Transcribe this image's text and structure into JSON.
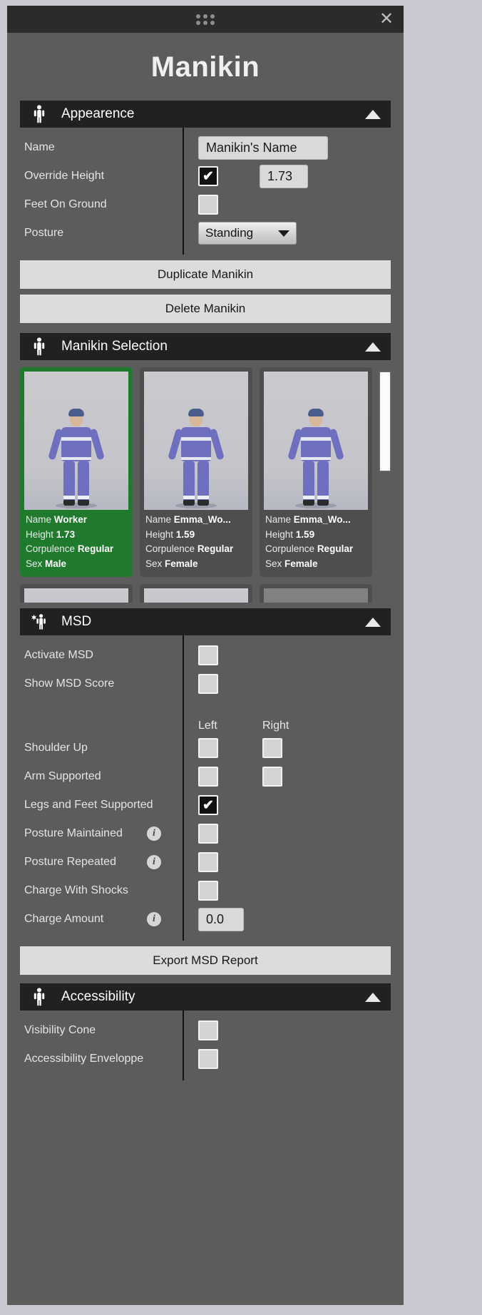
{
  "window": {
    "title": "Manikin",
    "close_label": "✕",
    "drag_handle": "drag-dots"
  },
  "appearance": {
    "header": "Appearence",
    "icon": "person-icon",
    "collapse_icon": "caret-up-icon",
    "rows": {
      "name_label": "Name",
      "name_value": "Manikin's Name",
      "override_height_label": "Override Height",
      "override_height_checked": true,
      "height_value": "1.73",
      "feet_on_ground_label": "Feet On Ground",
      "feet_on_ground_checked": false,
      "posture_label": "Posture",
      "posture_value": "Standing"
    },
    "duplicate_button": "Duplicate Manikin",
    "delete_button": "Delete Manikin"
  },
  "manikin_selection": {
    "header": "Manikin Selection",
    "icon": "person-icon",
    "collapse_icon": "caret-up-icon",
    "field_labels": {
      "name": "Name",
      "height": "Height",
      "corpulence": "Corpulence",
      "sex": "Sex"
    },
    "cards": [
      {
        "name": "Worker",
        "height": "1.73",
        "corpulence": "Regular",
        "sex": "Male",
        "selected": true,
        "cap_color": "#4a5c8c"
      },
      {
        "name": "Emma_Wo...",
        "height": "1.59",
        "corpulence": "Regular",
        "sex": "Female",
        "selected": false,
        "cap_color": "#4a5c8c"
      },
      {
        "name": "Emma_Wo...",
        "height": "1.59",
        "corpulence": "Regular",
        "sex": "Female",
        "selected": false,
        "cap_color": "#4a5c8c"
      }
    ],
    "partial_cards": [
      {
        "head_color": "#3b4f86",
        "dimmed": false
      },
      {
        "head_color": "#3fa05a",
        "dimmed": false
      },
      {
        "head_color": "#2b2018",
        "dimmed": true
      }
    ]
  },
  "msd": {
    "header": "MSD",
    "icon": "star-person-icon",
    "collapse_icon": "caret-up-icon",
    "activate_label": "Activate MSD",
    "activate_checked": false,
    "show_score_label": "Show MSD Score",
    "show_score_checked": false,
    "col_left": "Left",
    "col_right": "Right",
    "rows": [
      {
        "label": "Shoulder Up",
        "left": false,
        "right": false,
        "has_info": false,
        "two_sided": true
      },
      {
        "label": "Arm Supported",
        "left": false,
        "right": false,
        "has_info": false,
        "two_sided": true
      },
      {
        "label": "Legs and Feet Supported",
        "left": true,
        "right": null,
        "has_info": false,
        "two_sided": false
      },
      {
        "label": "Posture Maintained",
        "left": false,
        "right": null,
        "has_info": true,
        "two_sided": false
      },
      {
        "label": "Posture Repeated",
        "left": false,
        "right": null,
        "has_info": true,
        "two_sided": false
      },
      {
        "label": "Charge With Shocks",
        "left": false,
        "right": null,
        "has_info": false,
        "two_sided": false
      }
    ],
    "charge_amount_label": "Charge Amount",
    "charge_amount_has_info": true,
    "charge_amount_value": "0.0",
    "export_button": "Export MSD Report"
  },
  "accessibility": {
    "header": "Accessibility",
    "icon": "person-icon",
    "collapse_icon": "caret-up-icon",
    "rows": [
      {
        "label": "Visibility Cone",
        "checked": false
      },
      {
        "label": "Accessibility Enveloppe",
        "checked": false
      }
    ]
  },
  "colors": {
    "selected_card": "#1f7a2e",
    "section_header_bg": "#212121",
    "panel_bg": "#5c5c5c",
    "button_bg": "#dcdcdc"
  }
}
